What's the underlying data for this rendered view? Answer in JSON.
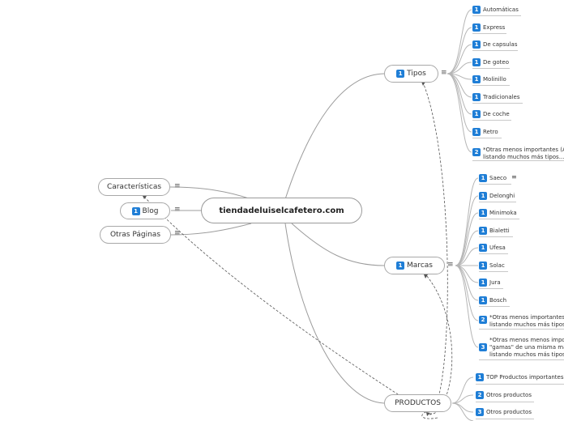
{
  "central": {
    "label": "tiendadeluiselcafetero.com"
  },
  "left_nodes": [
    {
      "label": "Características",
      "badge": ""
    },
    {
      "label": "Blog",
      "badge": "1"
    },
    {
      "label": "Otras Páginas",
      "badge": ""
    }
  ],
  "tipos": {
    "label": "Tipos",
    "badge": "1",
    "children": [
      {
        "badge": "1",
        "label": "Automáticas"
      },
      {
        "badge": "1",
        "label": "Express"
      },
      {
        "badge": "1",
        "label": "De capsulas"
      },
      {
        "badge": "1",
        "label": "De goteo"
      },
      {
        "badge": "1",
        "label": "Molinillo"
      },
      {
        "badge": "1",
        "label": "Tradicionales"
      },
      {
        "badge": "1",
        "label": "De coche"
      },
      {
        "badge": "1",
        "label": "Retro"
      },
      {
        "badge": "2",
        "label": "*Otras menos importantes (Ac",
        "label2": "listando muchos más tipos...)"
      }
    ]
  },
  "marcas": {
    "label": "Marcas",
    "badge": "1",
    "children": [
      {
        "badge": "1",
        "label": "Saeco"
      },
      {
        "badge": "1",
        "label": "Delonghi"
      },
      {
        "badge": "1",
        "label": "Minimoka"
      },
      {
        "badge": "1",
        "label": "Bialetti"
      },
      {
        "badge": "1",
        "label": "Ufesa"
      },
      {
        "badge": "1",
        "label": "Solac"
      },
      {
        "badge": "1",
        "label": "Jura"
      },
      {
        "badge": "1",
        "label": "Bosch"
      },
      {
        "badge": "2",
        "label": "*Otras menos importantes (",
        "label2": "listando muchos más tipos..."
      },
      {
        "badge": "3",
        "label": "*Otras menos menos impor",
        "label2": "\"gamas\" de una misma mar",
        "label3": "listando muchos más tipos..."
      }
    ]
  },
  "productos": {
    "label": "PRODUCTOS",
    "children": [
      {
        "badge": "1",
        "label": "TOP Productos importantes"
      },
      {
        "badge": "2",
        "label": "Otros productos"
      },
      {
        "badge": "3",
        "label": "Otros productos"
      }
    ]
  },
  "menu_glyph": "≡",
  "colors": {
    "badge": "#1f7ed6",
    "node_border": "#a8a8a8",
    "connector": "#999999",
    "dashed_relation": "#555555"
  }
}
